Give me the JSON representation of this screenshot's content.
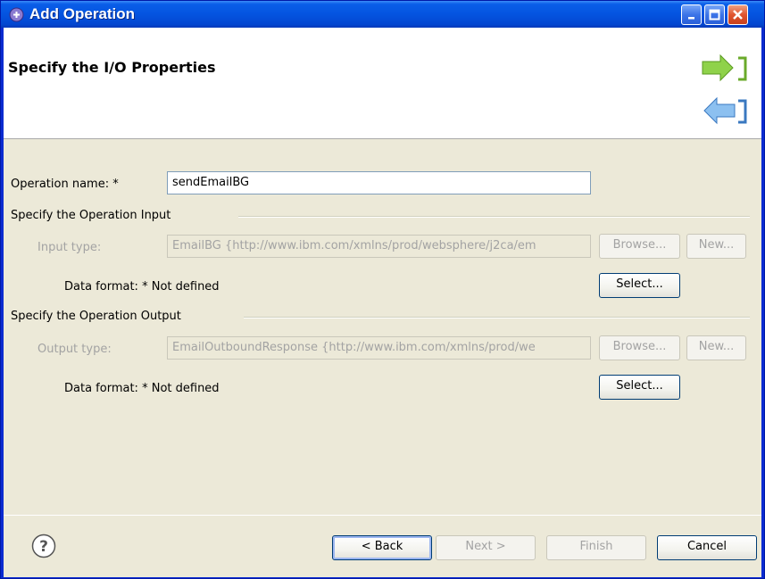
{
  "window": {
    "title": "Add Operation"
  },
  "banner": {
    "title": "Specify the I/O Properties"
  },
  "operation_name": {
    "label": "Operation name:",
    "required_mark": "*",
    "value": "sendEmailBG"
  },
  "input_section": {
    "heading": "Specify the Operation Input",
    "type_label": "Input type:",
    "type_value": "EmailBG  {http://www.ibm.com/xmlns/prod/websphere/j2ca/em",
    "browse_label": "Browse...",
    "new_label": "New...",
    "format_label": "Data format:",
    "required_mark": "*",
    "format_value": "Not defined",
    "select_label": "Select..."
  },
  "output_section": {
    "heading": "Specify the Operation Output",
    "type_label": "Output type:",
    "type_value": "EmailOutboundResponse  {http://www.ibm.com/xmlns/prod/we",
    "browse_label": "Browse...",
    "new_label": "New...",
    "format_label": "Data format:",
    "required_mark": "*",
    "format_value": "Not defined",
    "select_label": "Select..."
  },
  "footer": {
    "help_icon": "help-icon",
    "back_label": "< Back",
    "next_label": "Next >",
    "finish_label": "Finish",
    "cancel_label": "Cancel"
  },
  "colors": {
    "titlebar": "#0454e0",
    "dialog_bg": "#ece9d8",
    "disabled_text": "#a3a3a3"
  }
}
